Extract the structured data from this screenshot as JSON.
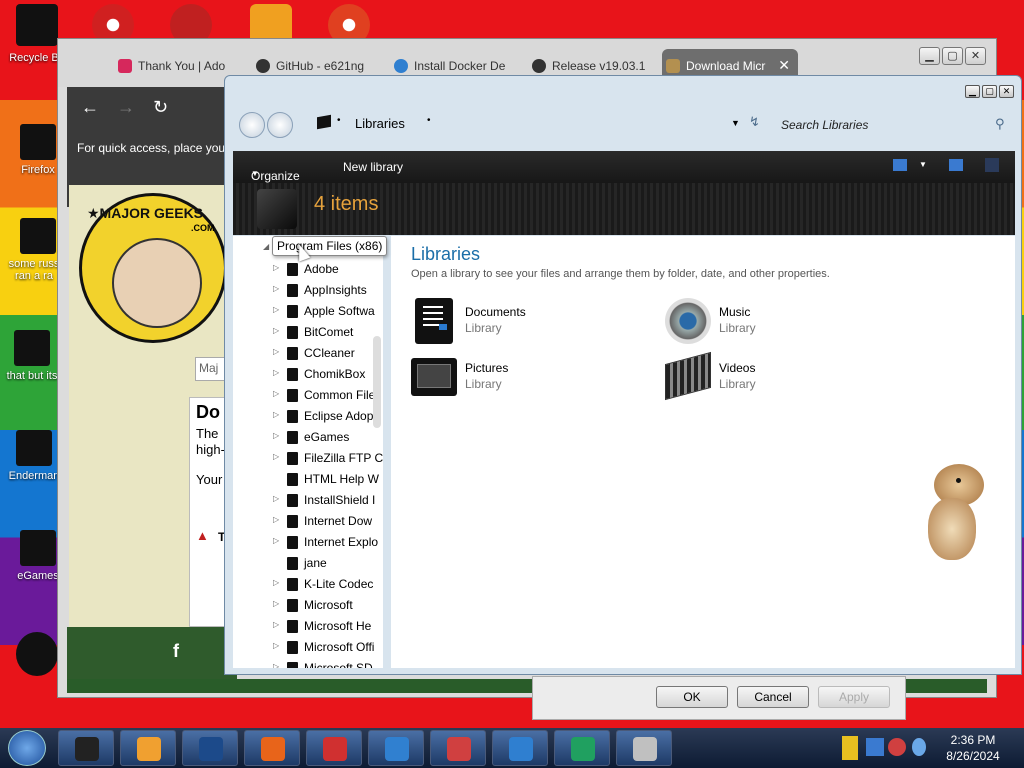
{
  "desktop": {
    "icons": [
      {
        "label": "Recycle B"
      },
      {
        "label": "Firefox"
      },
      {
        "label": "some russ ran a ra"
      },
      {
        "label": "that but its"
      },
      {
        "label": "Enderman"
      },
      {
        "label": "eGames"
      }
    ]
  },
  "browser": {
    "tabs": [
      {
        "label": "Thank You | Ado",
        "icon": "adobe-icon",
        "color": "#d6285c"
      },
      {
        "label": "GitHub - e621ng",
        "icon": "github-icon",
        "color": "#333333"
      },
      {
        "label": "Install Docker De",
        "icon": "docker-icon",
        "color": "#2f7fd0"
      },
      {
        "label": "Release v19.03.1",
        "icon": "github-icon",
        "color": "#333333"
      },
      {
        "label": "Download Micr",
        "icon": "majorgeeks-icon",
        "color": "#b39050"
      }
    ],
    "new_tab_symbol": "+",
    "close_tab_symbol": "✕",
    "quick_access_text": "For quick access, place your",
    "site": {
      "logo_text": "★MAJOR GEEKS",
      "logo_sub": ".COM",
      "search_text": "Maj",
      "card_heading": "Do",
      "card_line1": "The",
      "card_line2": "high-",
      "card_line3": "Your",
      "warning_text": "T",
      "facebook_symbol": "f"
    }
  },
  "explorer": {
    "breadcrumb": "Libraries",
    "search_placeholder": "Search Libraries",
    "toolbar": {
      "organize": "Organize",
      "new_library": "New library"
    },
    "item_count": "4 items",
    "tooltip": "Program Files (x86)",
    "tree": [
      {
        "label": "Program Files (x86)",
        "root": true
      },
      {
        "label": "Adobe",
        "arrow": true
      },
      {
        "label": "AppInsights",
        "arrow": true
      },
      {
        "label": "Apple Softwa",
        "arrow": true
      },
      {
        "label": "BitComet",
        "arrow": true
      },
      {
        "label": "CCleaner",
        "arrow": true
      },
      {
        "label": "ChomikBox",
        "arrow": true
      },
      {
        "label": "Common File",
        "arrow": true
      },
      {
        "label": "Eclipse Adopt",
        "arrow": true
      },
      {
        "label": "eGames",
        "arrow": true
      },
      {
        "label": "FileZilla FTP C",
        "arrow": true
      },
      {
        "label": "HTML Help W",
        "arrow": false
      },
      {
        "label": "InstallShield I",
        "arrow": true
      },
      {
        "label": "Internet Dow",
        "arrow": true
      },
      {
        "label": "Internet Explo",
        "arrow": true
      },
      {
        "label": "jane",
        "arrow": false
      },
      {
        "label": "K-Lite Codec",
        "arrow": true
      },
      {
        "label": "Microsoft",
        "arrow": true
      },
      {
        "label": "Microsoft He",
        "arrow": true
      },
      {
        "label": "Microsoft Offi",
        "arrow": true
      },
      {
        "label": "Microsoft SD",
        "arrow": true
      }
    ],
    "content": {
      "title": "Libraries",
      "description": "Open a library to see your files and arrange them by folder, date, and other properties.",
      "libraries": [
        {
          "name": "Documents",
          "type": "Library",
          "icon": "documents-icon"
        },
        {
          "name": "Music",
          "type": "Library",
          "icon": "music-icon"
        },
        {
          "name": "Pictures",
          "type": "Library",
          "icon": "pictures-icon"
        },
        {
          "name": "Videos",
          "type": "Library",
          "icon": "videos-icon"
        }
      ]
    }
  },
  "dialog": {
    "ok": "OK",
    "cancel": "Cancel",
    "apply": "Apply"
  },
  "taskbar": {
    "time": "2:36 PM",
    "date": "8/26/2024",
    "apps": [
      {
        "icon": "explorer-icon",
        "color": "#222222"
      },
      {
        "icon": "media-player-icon",
        "color": "#f0a030"
      },
      {
        "icon": "globe-icon",
        "color": "#1c4a8a"
      },
      {
        "icon": "firefox-icon",
        "color": "#e8641a"
      },
      {
        "icon": "flag-app-icon",
        "color": "#d03030"
      },
      {
        "icon": "network-globe-icon",
        "color": "#3080d0"
      },
      {
        "icon": "blocks-icon",
        "color": "#d04040"
      },
      {
        "icon": "docker-icon",
        "color": "#2f7fd0"
      },
      {
        "icon": "briefcase-icon",
        "color": "#20a060"
      },
      {
        "icon": "documents-app-icon",
        "color": "#c0c0c0"
      }
    ]
  }
}
